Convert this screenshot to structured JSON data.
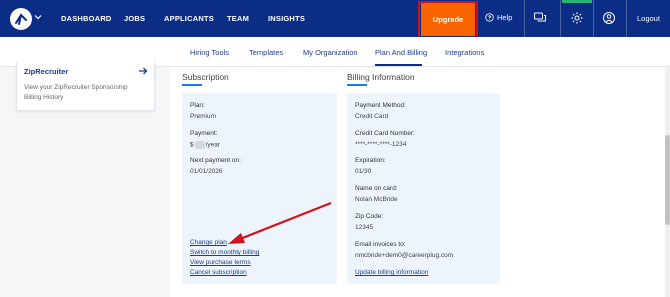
{
  "nav": {
    "items": [
      "DASHBOARD",
      "JOBS",
      "APPLICANTS",
      "TEAM",
      "INSIGHTS"
    ],
    "upgrade": "Upgrade",
    "help": "Help",
    "logout": "Logout"
  },
  "subnav": {
    "items": [
      "Hiring Tools",
      "Templates",
      "My Organization",
      "Plan And Billing",
      "Integrations"
    ],
    "active": "Plan And Billing"
  },
  "sidecard": {
    "title": "ZipRecruiter",
    "desc": "View your ZipRecruiter Sponsorship Billing History"
  },
  "subscription": {
    "heading": "Subscription",
    "plan_label": "Plan:",
    "plan_value": "Premium",
    "payment_label": "Payment:",
    "payment_prefix": "$",
    "payment_suffix": "/year",
    "next_label": "Next payment on:",
    "next_value": "01/01/2026",
    "links": [
      "Change plan",
      "Switch to monthly billing",
      "View purchase terms",
      "Cancel subscription"
    ]
  },
  "billing": {
    "heading": "Billing Information",
    "method_label": "Payment Method:",
    "method_value": "Credit Card",
    "card_label": "Credit Card Number:",
    "card_value": "****-****-****-1234",
    "exp_label": "Expiration:",
    "exp_value": "01/30",
    "name_label": "Name on card:",
    "name_value": "Nolan McBride",
    "zip_label": "Zip Code:",
    "zip_value": "12345",
    "email_label": "Email invoices to:",
    "email_value": "nmcbride+dem0@careerplug.com",
    "update_link": "Update billing information"
  },
  "colors": {
    "nav_bg": "#0b2d86",
    "upgrade_bg": "#fa6400",
    "highlight": "#d01318",
    "annotation_arrow": "#d01318"
  }
}
